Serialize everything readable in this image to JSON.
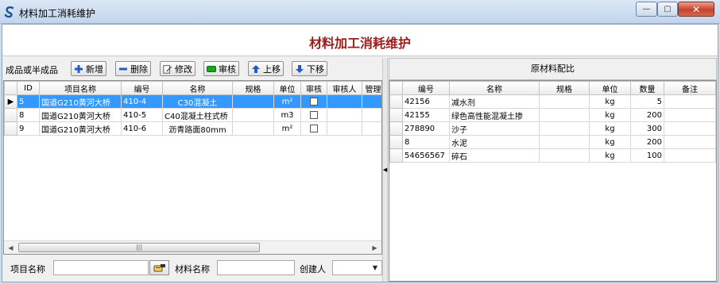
{
  "window": {
    "title": "材料加工消耗维护",
    "minimize_glyph": "—",
    "maximize_glyph": "▢",
    "close_glyph": "✕",
    "icon": "app-s-logo-icon"
  },
  "header": {
    "title": "材料加工消耗维护"
  },
  "toolbar": {
    "label": "成品或半成品",
    "buttons": [
      {
        "label": "新增",
        "icon": "plus-icon",
        "color": "#1f5fbf"
      },
      {
        "label": "删除",
        "icon": "minus-icon",
        "color": "#1f5fbf"
      },
      {
        "label": "修改",
        "icon": "edit-icon",
        "color": "#444444"
      },
      {
        "label": "审核",
        "icon": "green-check-icon",
        "color": "#1aa81a"
      },
      {
        "label": "上移",
        "icon": "arrow-up-icon",
        "color": "#1f5fbf"
      },
      {
        "label": "下移",
        "icon": "arrow-down-icon",
        "color": "#1f5fbf"
      }
    ]
  },
  "left_grid": {
    "columns": [
      "ID",
      "项目名称",
      "编号",
      "名称",
      "规格",
      "单位",
      "审核",
      "审核人",
      "管理"
    ],
    "rows": [
      {
        "id": "5",
        "project": "国道G210黄河大桥",
        "code": "410-4",
        "name": "C30混凝土",
        "spec": "",
        "unit": "m²",
        "approved": false,
        "approver": "",
        "admin": "",
        "selected": true
      },
      {
        "id": "8",
        "project": "国道G210黄河大桥",
        "code": "410-5",
        "name": "C40混凝土柱式桥",
        "spec": "",
        "unit": "m3",
        "approved": false,
        "approver": "",
        "admin": "",
        "selected": false
      },
      {
        "id": "9",
        "project": "国道G210黄河大桥",
        "code": "410-6",
        "name": "沥青路面80mm",
        "spec": "",
        "unit": "m²",
        "approved": false,
        "approver": "",
        "admin": "",
        "selected": false
      }
    ],
    "scroll_thumb_glyph": "|||"
  },
  "right_panel": {
    "title": "原材料配比",
    "columns": [
      "编号",
      "名称",
      "规格",
      "单位",
      "数量",
      "备注"
    ],
    "rows": [
      {
        "code": "42156",
        "name": "减水剂",
        "spec": "",
        "unit": "kg",
        "qty": "5",
        "note": ""
      },
      {
        "code": "42155",
        "name": "绿色高性能混凝土掺",
        "spec": "",
        "unit": "kg",
        "qty": "200",
        "note": ""
      },
      {
        "code": "278890",
        "name": "沙子",
        "spec": "",
        "unit": "kg",
        "qty": "300",
        "note": ""
      },
      {
        "code": "8",
        "name": "水泥",
        "spec": "",
        "unit": "kg",
        "qty": "200",
        "note": ""
      },
      {
        "code": "54656567",
        "name": "碎石",
        "spec": "",
        "unit": "kg",
        "qty": "100",
        "note": ""
      }
    ]
  },
  "filter": {
    "project_label": "项目名称",
    "project_value": "",
    "material_label": "材料名称",
    "material_value": "",
    "creator_label": "创建人",
    "creator_value": ""
  },
  "colors": {
    "title_red": "#9b1c1c",
    "selection_blue": "#3399ff"
  }
}
